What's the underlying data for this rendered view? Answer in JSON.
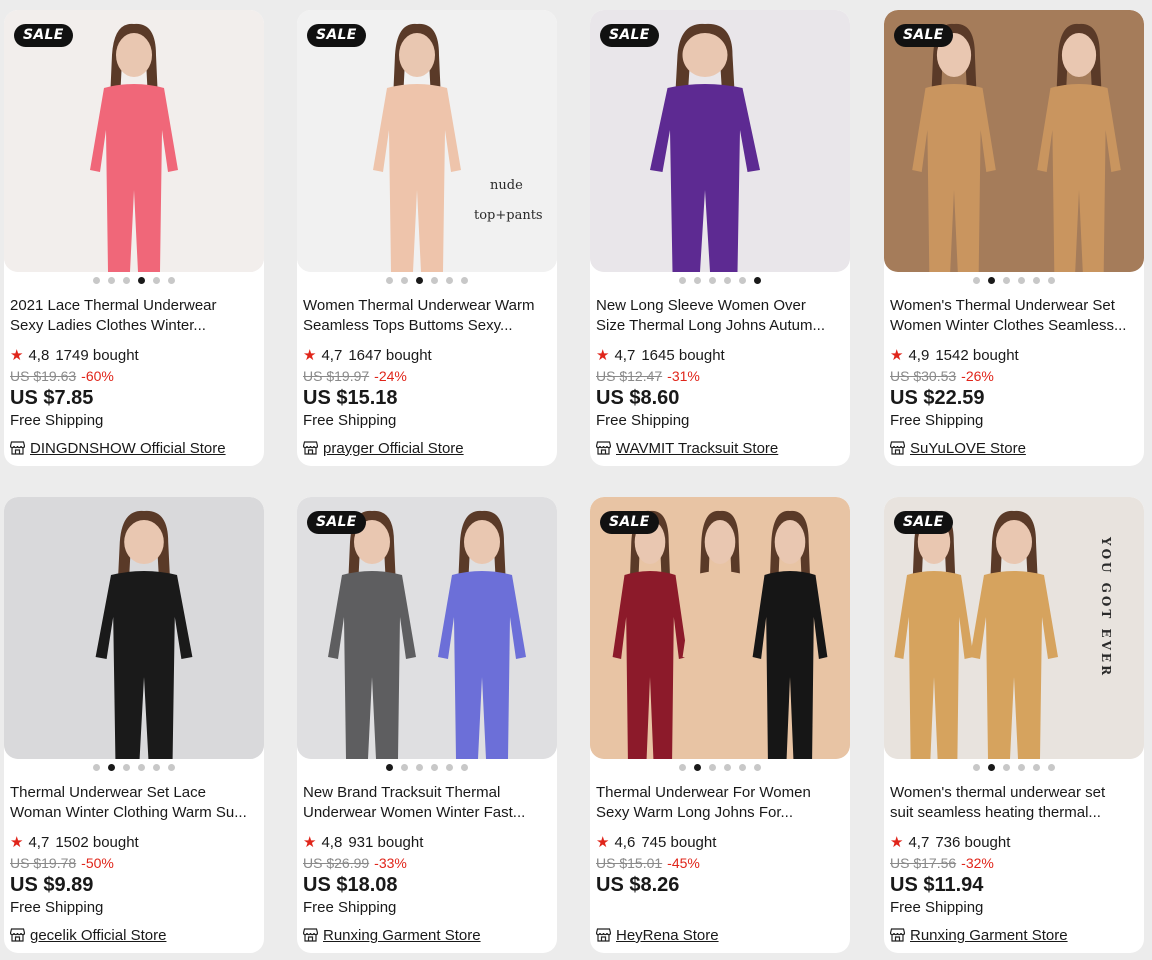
{
  "sale_badge_label": "SALE",
  "colors": {
    "sale_red": "#e0251a",
    "star_red": "#e0251a",
    "badge_black": "#111111",
    "background": "#ececec"
  },
  "products": [
    {
      "id": "p1",
      "sale": true,
      "image_colors": [
        "#f06779",
        "#f2eeec"
      ],
      "image_text": [],
      "dots": 6,
      "active_dot": 3,
      "title_line1": "2021 Lace Thermal Underwear",
      "title_line2": "Sexy Ladies Clothes Winter...",
      "rating": "4,8",
      "bought": "1749 bought",
      "old_price": "US $19.63",
      "discount": "-60%",
      "price": "US $7.85",
      "shipping": "Free Shipping",
      "store": "DINGDNSHOW Official Store",
      "store_icon": "store-icon"
    },
    {
      "id": "p2",
      "sale": true,
      "image_colors": [
        "#eec4ab",
        "#f1f1f1"
      ],
      "image_text": [
        "nude",
        "top+pants"
      ],
      "dots": 6,
      "active_dot": 2,
      "title_line1": "Women Thermal Underwear Warm",
      "title_line2": "Seamless Tops Buttoms Sexy...",
      "rating": "4,7",
      "bought": "1647 bought",
      "old_price": "US $19.97",
      "discount": "-24%",
      "price": "US $15.18",
      "shipping": "Free Shipping",
      "store": "prayger Official Store",
      "store_icon": "store-icon"
    },
    {
      "id": "p3",
      "sale": true,
      "image_colors": [
        "#5d2a92",
        "#e9e6ea"
      ],
      "image_text": [],
      "dots": 6,
      "active_dot": 5,
      "title_line1": "New Long Sleeve Women Over",
      "title_line2": "Size Thermal Long Johns Autum...",
      "rating": "4,7",
      "bought": "1645 bought",
      "old_price": "US $12.47",
      "discount": "-31%",
      "price": "US $8.60",
      "shipping": "Free Shipping",
      "store": "WAVMIT Tracksuit Store",
      "store_icon": "store-icon"
    },
    {
      "id": "p4",
      "sale": true,
      "image_colors": [
        "#c9955f",
        "#a57c5a"
      ],
      "image_text": [],
      "dots": 6,
      "active_dot": 1,
      "title_line1": "Women's Thermal Underwear Set",
      "title_line2": "Women Winter Clothes Seamless...",
      "rating": "4,9",
      "bought": "1542 bought",
      "old_price": "US $30.53",
      "discount": "-26%",
      "price": "US $22.59",
      "shipping": "Free Shipping",
      "store": "SuYuLOVE Store",
      "store_icon": "store-icon"
    },
    {
      "id": "p5",
      "sale": false,
      "image_colors": [
        "#1a1a1a",
        "#d9d9db"
      ],
      "image_text": [],
      "dots": 6,
      "active_dot": 1,
      "title_line1": "Thermal Underwear Set Lace",
      "title_line2": "Woman Winter Clothing Warm Su...",
      "rating": "4,7",
      "bought": "1502 bought",
      "old_price": "US $19.78",
      "discount": "-50%",
      "price": "US $9.89",
      "shipping": "Free Shipping",
      "store": "gecelik Official Store",
      "store_icon": "store-icon"
    },
    {
      "id": "p6",
      "sale": true,
      "image_colors": [
        "#5e5e60",
        "#6c6fd8"
      ],
      "image_text": [],
      "dots": 6,
      "active_dot": 0,
      "title_line1": "New Brand Tracksuit Thermal",
      "title_line2": "Underwear Women Winter Fast...",
      "rating": "4,8",
      "bought": "931 bought",
      "old_price": "US $26.99",
      "discount": "-33%",
      "price": "US $18.08",
      "shipping": "Free Shipping",
      "store": "Runxing Garment Store",
      "store_icon": "store-icon"
    },
    {
      "id": "p7",
      "sale": true,
      "image_colors": [
        "#8c1a2a",
        "#e8c4a4"
      ],
      "image_text": [],
      "dots": 6,
      "active_dot": 1,
      "title_line1": "Thermal Underwear For Women",
      "title_line2": "Sexy Warm Long Johns For...",
      "rating": "4,6",
      "bought": "745 bought",
      "old_price": "US $15.01",
      "discount": "-45%",
      "price": "US $8.26",
      "shipping": "",
      "store": "HeyRena Store",
      "store_icon": "store-icon"
    },
    {
      "id": "p8",
      "sale": true,
      "image_colors": [
        "#d6a35e",
        "#e8e3de"
      ],
      "image_text": [
        "YOU GOT EVER"
      ],
      "dots": 6,
      "active_dot": 1,
      "title_line1": "Women's thermal underwear set",
      "title_line2": "suit seamless heating thermal...",
      "rating": "4,7",
      "bought": "736 bought",
      "old_price": "US $17.56",
      "discount": "-32%",
      "price": "US $11.94",
      "shipping": "Free Shipping",
      "store": "Runxing Garment Store",
      "store_icon": "store-icon"
    }
  ]
}
